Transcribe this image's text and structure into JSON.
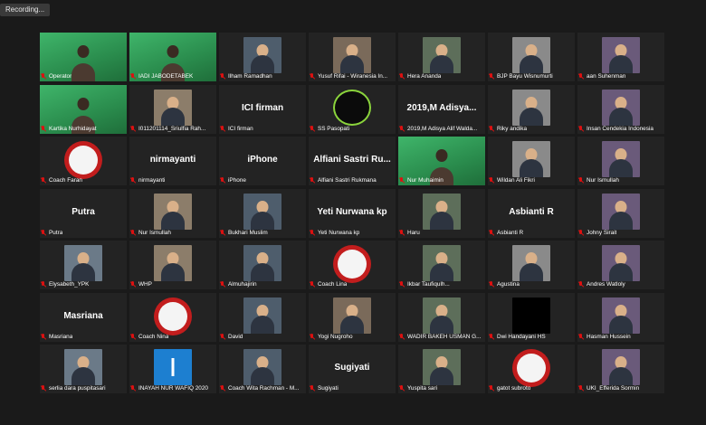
{
  "recording": {
    "label": "Recording..."
  },
  "participants": [
    {
      "name": "Operator",
      "tile": "green"
    },
    {
      "name": "IADI JABODETABEK",
      "tile": "green2"
    },
    {
      "name": "Ilham Ramadhan",
      "tile": "thumb"
    },
    {
      "name": "Yusuf Rifai - Wiranesia In...",
      "tile": "thumb"
    },
    {
      "name": "Hera Ananda",
      "tile": "thumb"
    },
    {
      "name": "BJP Bayu Wisnumurti",
      "tile": "thumb"
    },
    {
      "name": "aan Suhenman",
      "tile": "thumb"
    },
    {
      "name": "Kartika Nurhidayat",
      "tile": "green"
    },
    {
      "name": "I011201114_Sriulfia Rah...",
      "tile": "thumb"
    },
    {
      "name": "ICI firman",
      "tile": "text",
      "display": "ICI firman"
    },
    {
      "name": "SS Pasopati",
      "tile": "logo"
    },
    {
      "name": "2019,M Adisya Alif Walda...",
      "tile": "text",
      "display": "2019,M  Adisya..."
    },
    {
      "name": "Riky andika",
      "tile": "thumb"
    },
    {
      "name": "Insan Cendekia Indonesia",
      "tile": "thumb"
    },
    {
      "name": "Coach Faran",
      "tile": "coach"
    },
    {
      "name": "nirmayanti",
      "tile": "text",
      "display": "nirmayanti"
    },
    {
      "name": "iPhone",
      "tile": "text",
      "display": "iPhone"
    },
    {
      "name": "Alfiani Sastri Rukmana",
      "tile": "text",
      "display": "Alfiani  Sastri  Ru..."
    },
    {
      "name": "Nur Muhaimin",
      "tile": "green"
    },
    {
      "name": "Wildan Ali Fikri",
      "tile": "thumb"
    },
    {
      "name": "Nur Ismullah",
      "tile": "thumb"
    },
    {
      "name": "Putra",
      "tile": "text",
      "display": "Putra"
    },
    {
      "name": "Nur Ismullah",
      "tile": "thumb"
    },
    {
      "name": "Bukhari Muslim",
      "tile": "thumb"
    },
    {
      "name": "Yeti Nurwana kp",
      "tile": "text",
      "display": "Yeti Nurwana kp"
    },
    {
      "name": "Haru",
      "tile": "thumb"
    },
    {
      "name": "Asbianti R",
      "tile": "text",
      "display": "Asbianti R"
    },
    {
      "name": "Johny Sirait",
      "tile": "thumb"
    },
    {
      "name": "Elysabeth_YPK",
      "tile": "thumb"
    },
    {
      "name": "WHP",
      "tile": "thumb"
    },
    {
      "name": "Almuhajirin",
      "tile": "thumb"
    },
    {
      "name": "Coach Lina",
      "tile": "coach"
    },
    {
      "name": "Ikbar Taufiqulh...",
      "tile": "thumb"
    },
    {
      "name": "Agustina",
      "tile": "thumb"
    },
    {
      "name": "Andres Watloly",
      "tile": "thumb"
    },
    {
      "name": "Masriana",
      "tile": "text",
      "display": "Masriana"
    },
    {
      "name": "Coach Nina",
      "tile": "coach"
    },
    {
      "name": "David",
      "tile": "thumb"
    },
    {
      "name": "Yogi Nugroho",
      "tile": "thumb"
    },
    {
      "name": "WADIR BAKEH USMAN G...",
      "tile": "thumb"
    },
    {
      "name": "Dwi Handayani HS",
      "tile": "black"
    },
    {
      "name": "Hasman Hussein",
      "tile": "thumb"
    },
    {
      "name": "serlia dara puspitasari",
      "tile": "thumb"
    },
    {
      "name": "INAYAH NUR WAFIQ 2020",
      "tile": "blue"
    },
    {
      "name": "Coach Wita Rachman - M...",
      "tile": "thumb"
    },
    {
      "name": "Sugiyati",
      "tile": "text",
      "display": "Sugiyati"
    },
    {
      "name": "Yuspita sari",
      "tile": "thumb"
    },
    {
      "name": "gatot subroto",
      "tile": "coach"
    },
    {
      "name": "UKI_Efferida Sormin",
      "tile": "thumb"
    }
  ],
  "colors": {
    "background": "#1a1a1a",
    "tile": "#232323",
    "active_border": "#8bd43c",
    "mic_muted": "#dd1111",
    "green_bg": "#2f9f59",
    "coach_red": "#c21d1d"
  }
}
